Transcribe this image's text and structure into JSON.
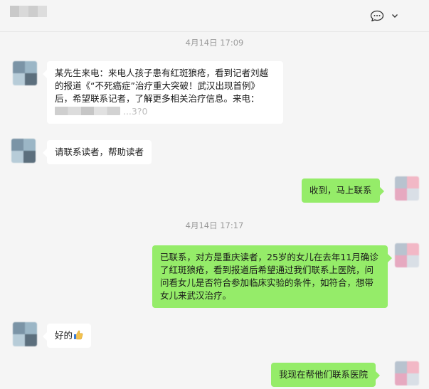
{
  "header": {
    "chat_icon": "chat-bubble-icon",
    "menu_icon": "chevron-down-icon"
  },
  "messages": [
    {
      "type": "time",
      "text": "4月14日 17:09"
    },
    {
      "type": "incoming",
      "text_before": "某先生来电：来电人孩子患有红斑狼疮，看到记者刘越的报道《“不死癌症”治疗重大突破！武汉出现首例》后，希望联系记者，了解更多相关治疗信息。来电：",
      "text_after": "...3?0"
    },
    {
      "type": "incoming",
      "text": "请联系读者，帮助读者"
    },
    {
      "type": "outgoing",
      "text": "收到，马上联系"
    },
    {
      "type": "time",
      "text": "4月14日 17:17"
    },
    {
      "type": "outgoing",
      "text": "已联系，对方是重庆读者，25岁的女儿在去年11月确诊了红斑狼疮，看到报道后希望通过我们联系上医院，问问看女儿是否符合参加临床实验的条件，如符合，想带女儿来武汉治疗。"
    },
    {
      "type": "incoming",
      "text": "好的",
      "emoji": "thumbs-up-emoji"
    },
    {
      "type": "outgoing",
      "text": "我现在帮他们联系医院"
    }
  ]
}
